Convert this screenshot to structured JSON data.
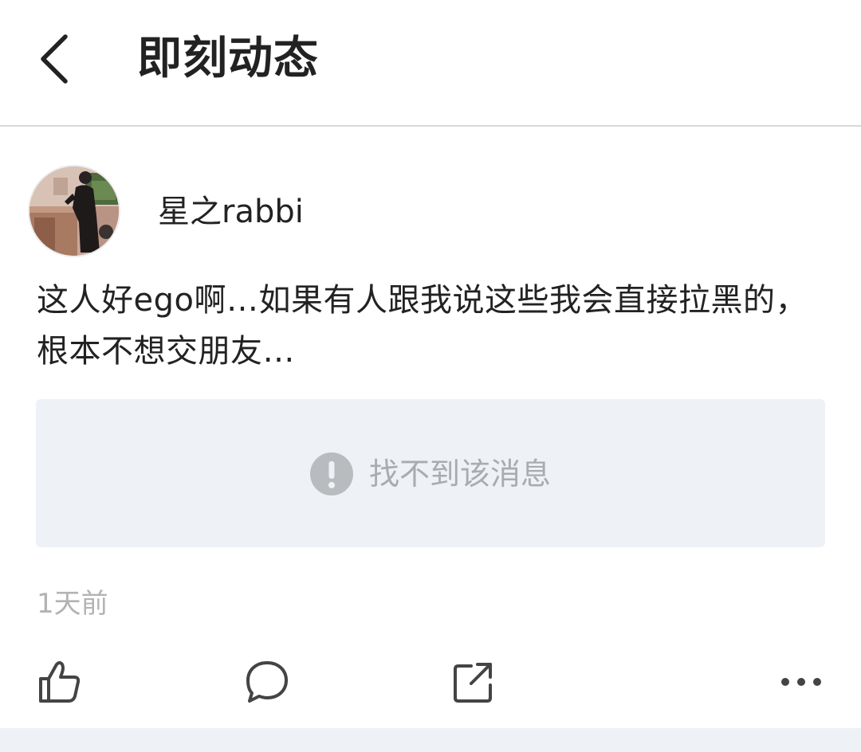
{
  "header": {
    "title": "即刻动态"
  },
  "post": {
    "author": "星之rabbi",
    "text": "这人好ego啊…如果有人跟我说这些我会直接拉黑的，根本不想交朋友…",
    "quoted": {
      "notice": "找不到该消息"
    },
    "timestamp": "1天前"
  },
  "icons": {
    "back": "chevron-left-icon",
    "like": "thumbs-up-icon",
    "comment": "speech-bubble-icon",
    "share": "share-out-icon",
    "more": "more-horizontal-icon",
    "notice": "exclamation-circle-icon"
  },
  "colors": {
    "quote_background": "#eef2f6",
    "notice_gray": "#b3b3b3",
    "text": "#222222"
  }
}
